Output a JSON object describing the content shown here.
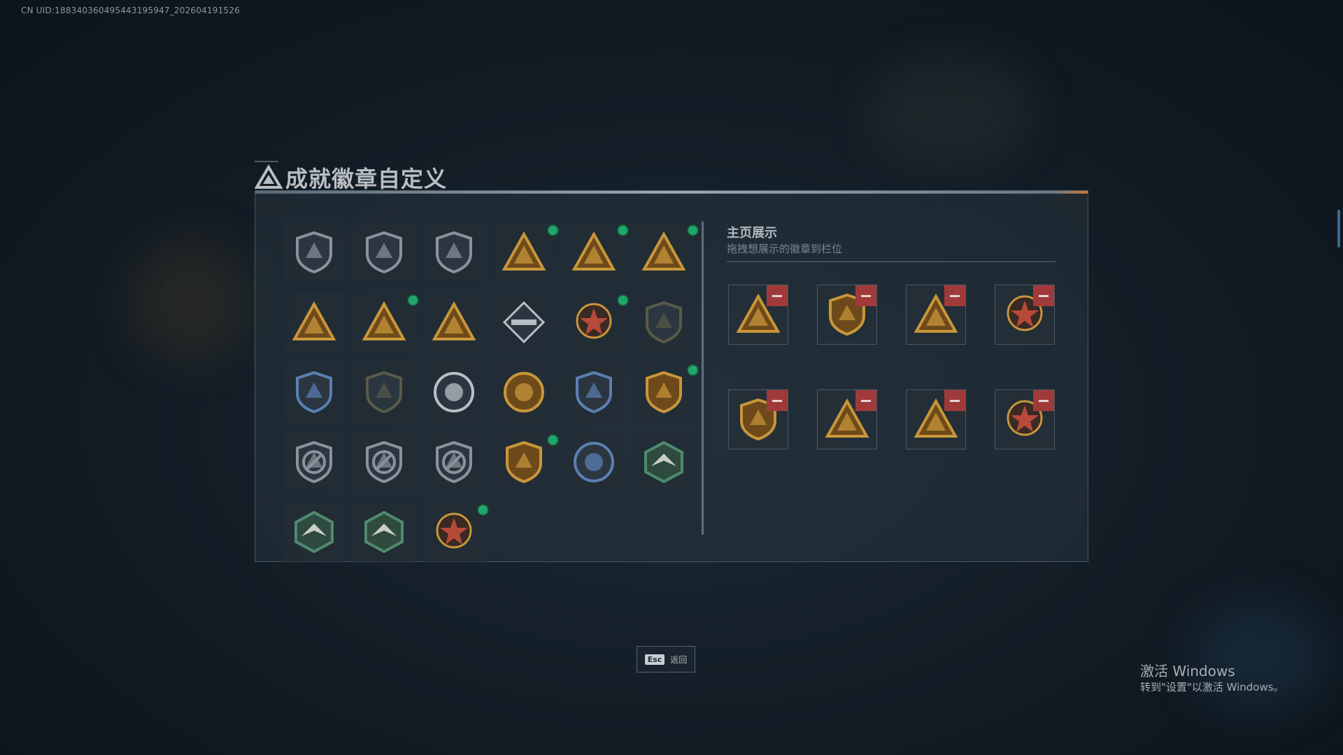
{
  "uid_text": "CN UID:188340360495443195947_202604191526",
  "page": {
    "title": "成就徽章自定义",
    "title_icon": "triangle-emblem-icon"
  },
  "badges": [
    {
      "icon": "shield-triangle-badge",
      "style": "gray",
      "new": false
    },
    {
      "icon": "helicopter-badge",
      "style": "gray",
      "new": false
    },
    {
      "icon": "shield-arrow-badge",
      "style": "gray",
      "new": false
    },
    {
      "icon": "triangle-56-badge",
      "style": "gold",
      "new": true
    },
    {
      "icon": "triangle-hat-badge",
      "style": "gold",
      "new": true
    },
    {
      "icon": "triangle-rifle-badge",
      "style": "gold",
      "new": true
    },
    {
      "icon": "triangle-number-1-badge",
      "style": "gold",
      "new": false
    },
    {
      "icon": "triangle-crate-badge",
      "style": "gold",
      "new": true
    },
    {
      "icon": "triangle-soldiers-badge",
      "style": "gold",
      "new": false
    },
    {
      "icon": "diamond-launcher-badge",
      "style": "silver",
      "new": false
    },
    {
      "icon": "red-star-medal-badge",
      "style": "red",
      "new": true
    },
    {
      "icon": "shield-emblem-badge",
      "style": "dark",
      "new": false
    },
    {
      "icon": "police-shield-badge",
      "style": "blue",
      "new": false
    },
    {
      "icon": "dark-crest-badge",
      "style": "dark",
      "new": false
    },
    {
      "icon": "skull-round-badge",
      "style": "silver",
      "new": false
    },
    {
      "icon": "tank-sunburst-badge",
      "style": "gold",
      "new": false
    },
    {
      "icon": "blue-crosshair-shield-badge",
      "style": "blue",
      "new": false
    },
    {
      "icon": "gold-crest-shield-badge",
      "style": "gold",
      "new": true
    },
    {
      "icon": "shield-no-rifle-badge",
      "style": "gray",
      "new": false
    },
    {
      "icon": "shield-no-smg-badge",
      "style": "gray",
      "new": false
    },
    {
      "icon": "shield-no-pistol-badge",
      "style": "gray",
      "new": false
    },
    {
      "icon": "gold-crossed-guns-shield-badge",
      "style": "gold",
      "new": true
    },
    {
      "icon": "eagle-round-badge",
      "style": "blue",
      "new": false
    },
    {
      "icon": "green-hex-fighter-badge",
      "style": "green",
      "new": false
    },
    {
      "icon": "green-hex-wolf-badge",
      "style": "green",
      "new": false
    },
    {
      "icon": "green-hex-jet-badge",
      "style": "green",
      "new": false
    },
    {
      "icon": "red-dragon-badge",
      "style": "red",
      "new": true
    }
  ],
  "showcase": {
    "title": "主页展示",
    "subtitle": "拖拽想展示的徽章到栏位",
    "slots": [
      {
        "icon": "triangle-56-badge",
        "style": "gold",
        "remove_icon": "minus-icon"
      },
      {
        "icon": "gold-crest-shield-badge",
        "style": "gold",
        "remove_icon": "minus-icon"
      },
      {
        "icon": "triangle-hat-badge",
        "style": "gold",
        "remove_icon": "minus-icon"
      },
      {
        "icon": "red-dragon-badge",
        "style": "red",
        "remove_icon": "minus-icon"
      },
      {
        "icon": "gold-crossed-guns-shield-badge",
        "style": "gold",
        "remove_icon": "minus-icon"
      },
      {
        "icon": "triangle-crate-badge",
        "style": "gold",
        "remove_icon": "minus-icon"
      },
      {
        "icon": "triangle-rifle-badge",
        "style": "gold",
        "remove_icon": "minus-icon"
      },
      {
        "icon": "red-star-medal-badge",
        "style": "red",
        "remove_icon": "minus-icon"
      }
    ]
  },
  "footer": {
    "esc_key": "Esc",
    "esc_label": "返回"
  },
  "watermark": {
    "title": "激活 Windows",
    "subtitle": "转到\"设置\"以激活 Windows。"
  },
  "colors": {
    "gold": "#c8963a",
    "gold_dark": "#6e4a1a",
    "gray": "#8a939b",
    "silver": "#b7bfc6",
    "blue": "#5b7fb3",
    "red": "#b84a3a",
    "green": "#4f8a6e",
    "dark": "#5a5a48",
    "new_dot": "#1fa66b",
    "remove": "#a03a3a"
  }
}
